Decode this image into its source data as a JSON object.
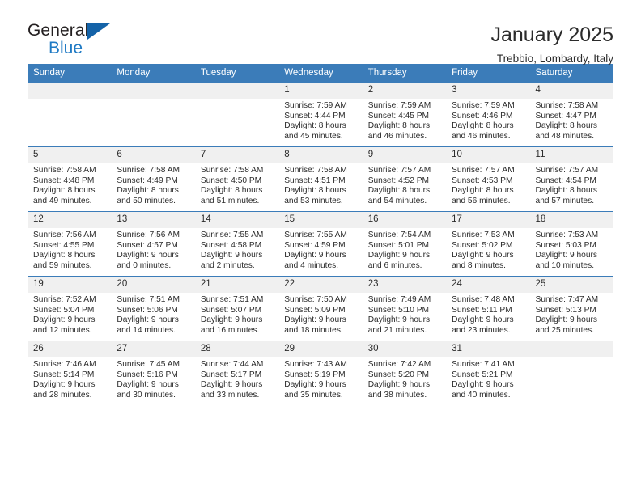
{
  "brand": {
    "word1": "General",
    "word2": "Blue",
    "triangle_color": "#1463a8",
    "blue_color": "#1f7ac4"
  },
  "header": {
    "title": "January 2025",
    "subtitle": "Trebbio, Lombardy, Italy"
  },
  "theme": {
    "header_row_bg": "#3b7cb9",
    "daynum_bg": "#f0f0f0",
    "text": "#2b2b2b"
  },
  "weekday_headers": [
    "Sunday",
    "Monday",
    "Tuesday",
    "Wednesday",
    "Thursday",
    "Friday",
    "Saturday"
  ],
  "weeks": [
    [
      {
        "day": "",
        "lines": []
      },
      {
        "day": "",
        "lines": []
      },
      {
        "day": "",
        "lines": []
      },
      {
        "day": "1",
        "lines": [
          "Sunrise: 7:59 AM",
          "Sunset: 4:44 PM",
          "Daylight: 8 hours",
          "and 45 minutes."
        ]
      },
      {
        "day": "2",
        "lines": [
          "Sunrise: 7:59 AM",
          "Sunset: 4:45 PM",
          "Daylight: 8 hours",
          "and 46 minutes."
        ]
      },
      {
        "day": "3",
        "lines": [
          "Sunrise: 7:59 AM",
          "Sunset: 4:46 PM",
          "Daylight: 8 hours",
          "and 46 minutes."
        ]
      },
      {
        "day": "4",
        "lines": [
          "Sunrise: 7:58 AM",
          "Sunset: 4:47 PM",
          "Daylight: 8 hours",
          "and 48 minutes."
        ]
      }
    ],
    [
      {
        "day": "5",
        "lines": [
          "Sunrise: 7:58 AM",
          "Sunset: 4:48 PM",
          "Daylight: 8 hours",
          "and 49 minutes."
        ]
      },
      {
        "day": "6",
        "lines": [
          "Sunrise: 7:58 AM",
          "Sunset: 4:49 PM",
          "Daylight: 8 hours",
          "and 50 minutes."
        ]
      },
      {
        "day": "7",
        "lines": [
          "Sunrise: 7:58 AM",
          "Sunset: 4:50 PM",
          "Daylight: 8 hours",
          "and 51 minutes."
        ]
      },
      {
        "day": "8",
        "lines": [
          "Sunrise: 7:58 AM",
          "Sunset: 4:51 PM",
          "Daylight: 8 hours",
          "and 53 minutes."
        ]
      },
      {
        "day": "9",
        "lines": [
          "Sunrise: 7:57 AM",
          "Sunset: 4:52 PM",
          "Daylight: 8 hours",
          "and 54 minutes."
        ]
      },
      {
        "day": "10",
        "lines": [
          "Sunrise: 7:57 AM",
          "Sunset: 4:53 PM",
          "Daylight: 8 hours",
          "and 56 minutes."
        ]
      },
      {
        "day": "11",
        "lines": [
          "Sunrise: 7:57 AM",
          "Sunset: 4:54 PM",
          "Daylight: 8 hours",
          "and 57 minutes."
        ]
      }
    ],
    [
      {
        "day": "12",
        "lines": [
          "Sunrise: 7:56 AM",
          "Sunset: 4:55 PM",
          "Daylight: 8 hours",
          "and 59 minutes."
        ]
      },
      {
        "day": "13",
        "lines": [
          "Sunrise: 7:56 AM",
          "Sunset: 4:57 PM",
          "Daylight: 9 hours",
          "and 0 minutes."
        ]
      },
      {
        "day": "14",
        "lines": [
          "Sunrise: 7:55 AM",
          "Sunset: 4:58 PM",
          "Daylight: 9 hours",
          "and 2 minutes."
        ]
      },
      {
        "day": "15",
        "lines": [
          "Sunrise: 7:55 AM",
          "Sunset: 4:59 PM",
          "Daylight: 9 hours",
          "and 4 minutes."
        ]
      },
      {
        "day": "16",
        "lines": [
          "Sunrise: 7:54 AM",
          "Sunset: 5:01 PM",
          "Daylight: 9 hours",
          "and 6 minutes."
        ]
      },
      {
        "day": "17",
        "lines": [
          "Sunrise: 7:53 AM",
          "Sunset: 5:02 PM",
          "Daylight: 9 hours",
          "and 8 minutes."
        ]
      },
      {
        "day": "18",
        "lines": [
          "Sunrise: 7:53 AM",
          "Sunset: 5:03 PM",
          "Daylight: 9 hours",
          "and 10 minutes."
        ]
      }
    ],
    [
      {
        "day": "19",
        "lines": [
          "Sunrise: 7:52 AM",
          "Sunset: 5:04 PM",
          "Daylight: 9 hours",
          "and 12 minutes."
        ]
      },
      {
        "day": "20",
        "lines": [
          "Sunrise: 7:51 AM",
          "Sunset: 5:06 PM",
          "Daylight: 9 hours",
          "and 14 minutes."
        ]
      },
      {
        "day": "21",
        "lines": [
          "Sunrise: 7:51 AM",
          "Sunset: 5:07 PM",
          "Daylight: 9 hours",
          "and 16 minutes."
        ]
      },
      {
        "day": "22",
        "lines": [
          "Sunrise: 7:50 AM",
          "Sunset: 5:09 PM",
          "Daylight: 9 hours",
          "and 18 minutes."
        ]
      },
      {
        "day": "23",
        "lines": [
          "Sunrise: 7:49 AM",
          "Sunset: 5:10 PM",
          "Daylight: 9 hours",
          "and 21 minutes."
        ]
      },
      {
        "day": "24",
        "lines": [
          "Sunrise: 7:48 AM",
          "Sunset: 5:11 PM",
          "Daylight: 9 hours",
          "and 23 minutes."
        ]
      },
      {
        "day": "25",
        "lines": [
          "Sunrise: 7:47 AM",
          "Sunset: 5:13 PM",
          "Daylight: 9 hours",
          "and 25 minutes."
        ]
      }
    ],
    [
      {
        "day": "26",
        "lines": [
          "Sunrise: 7:46 AM",
          "Sunset: 5:14 PM",
          "Daylight: 9 hours",
          "and 28 minutes."
        ]
      },
      {
        "day": "27",
        "lines": [
          "Sunrise: 7:45 AM",
          "Sunset: 5:16 PM",
          "Daylight: 9 hours",
          "and 30 minutes."
        ]
      },
      {
        "day": "28",
        "lines": [
          "Sunrise: 7:44 AM",
          "Sunset: 5:17 PM",
          "Daylight: 9 hours",
          "and 33 minutes."
        ]
      },
      {
        "day": "29",
        "lines": [
          "Sunrise: 7:43 AM",
          "Sunset: 5:19 PM",
          "Daylight: 9 hours",
          "and 35 minutes."
        ]
      },
      {
        "day": "30",
        "lines": [
          "Sunrise: 7:42 AM",
          "Sunset: 5:20 PM",
          "Daylight: 9 hours",
          "and 38 minutes."
        ]
      },
      {
        "day": "31",
        "lines": [
          "Sunrise: 7:41 AM",
          "Sunset: 5:21 PM",
          "Daylight: 9 hours",
          "and 40 minutes."
        ]
      },
      {
        "day": "",
        "lines": []
      }
    ]
  ]
}
